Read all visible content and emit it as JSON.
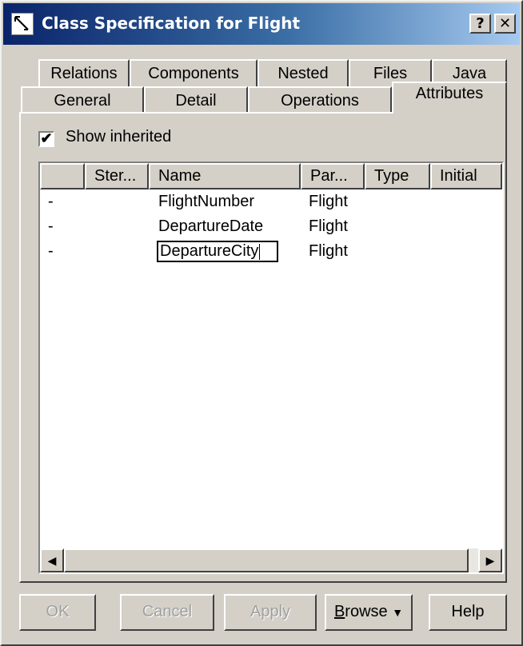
{
  "window": {
    "title": "Class Specification for Flight",
    "help_label": "?",
    "close_label": "✕"
  },
  "tabs": {
    "row_back": [
      "Relations",
      "Components",
      "Nested",
      "Files",
      "Java"
    ],
    "row_front": [
      "General",
      "Detail",
      "Operations",
      "Attributes"
    ],
    "active": "Attributes"
  },
  "show_inherited": {
    "label": "Show inherited",
    "checked": true,
    "mark": "✔"
  },
  "attributes_table": {
    "columns": [
      "",
      "Ster...",
      "Name",
      "Par...",
      "Type",
      "Initial"
    ],
    "rows": [
      {
        "marker": "-",
        "stereotype": "",
        "name": "FlightNumber",
        "parent": "Flight",
        "type": "",
        "initial": ""
      },
      {
        "marker": "-",
        "stereotype": "",
        "name": "DepartureDate",
        "parent": "Flight",
        "type": "",
        "initial": ""
      },
      {
        "marker": "-",
        "stereotype": "",
        "name": "DepartureCity",
        "parent": "Flight",
        "type": "",
        "initial": "",
        "editing": true
      }
    ]
  },
  "scrollbar": {
    "left_arrow": "◀",
    "right_arrow": "▶"
  },
  "buttons": {
    "ok": "OK",
    "cancel": "Cancel",
    "apply": "Apply",
    "browse_first": "B",
    "browse_rest": "rowse",
    "browse_arrow": "▼",
    "help": "Help"
  },
  "colors": {
    "face": "#d4d0c8",
    "title_gradient_start": "#0a246a",
    "title_gradient_end": "#a6caf0",
    "disabled_text": "#a0a0a0"
  }
}
